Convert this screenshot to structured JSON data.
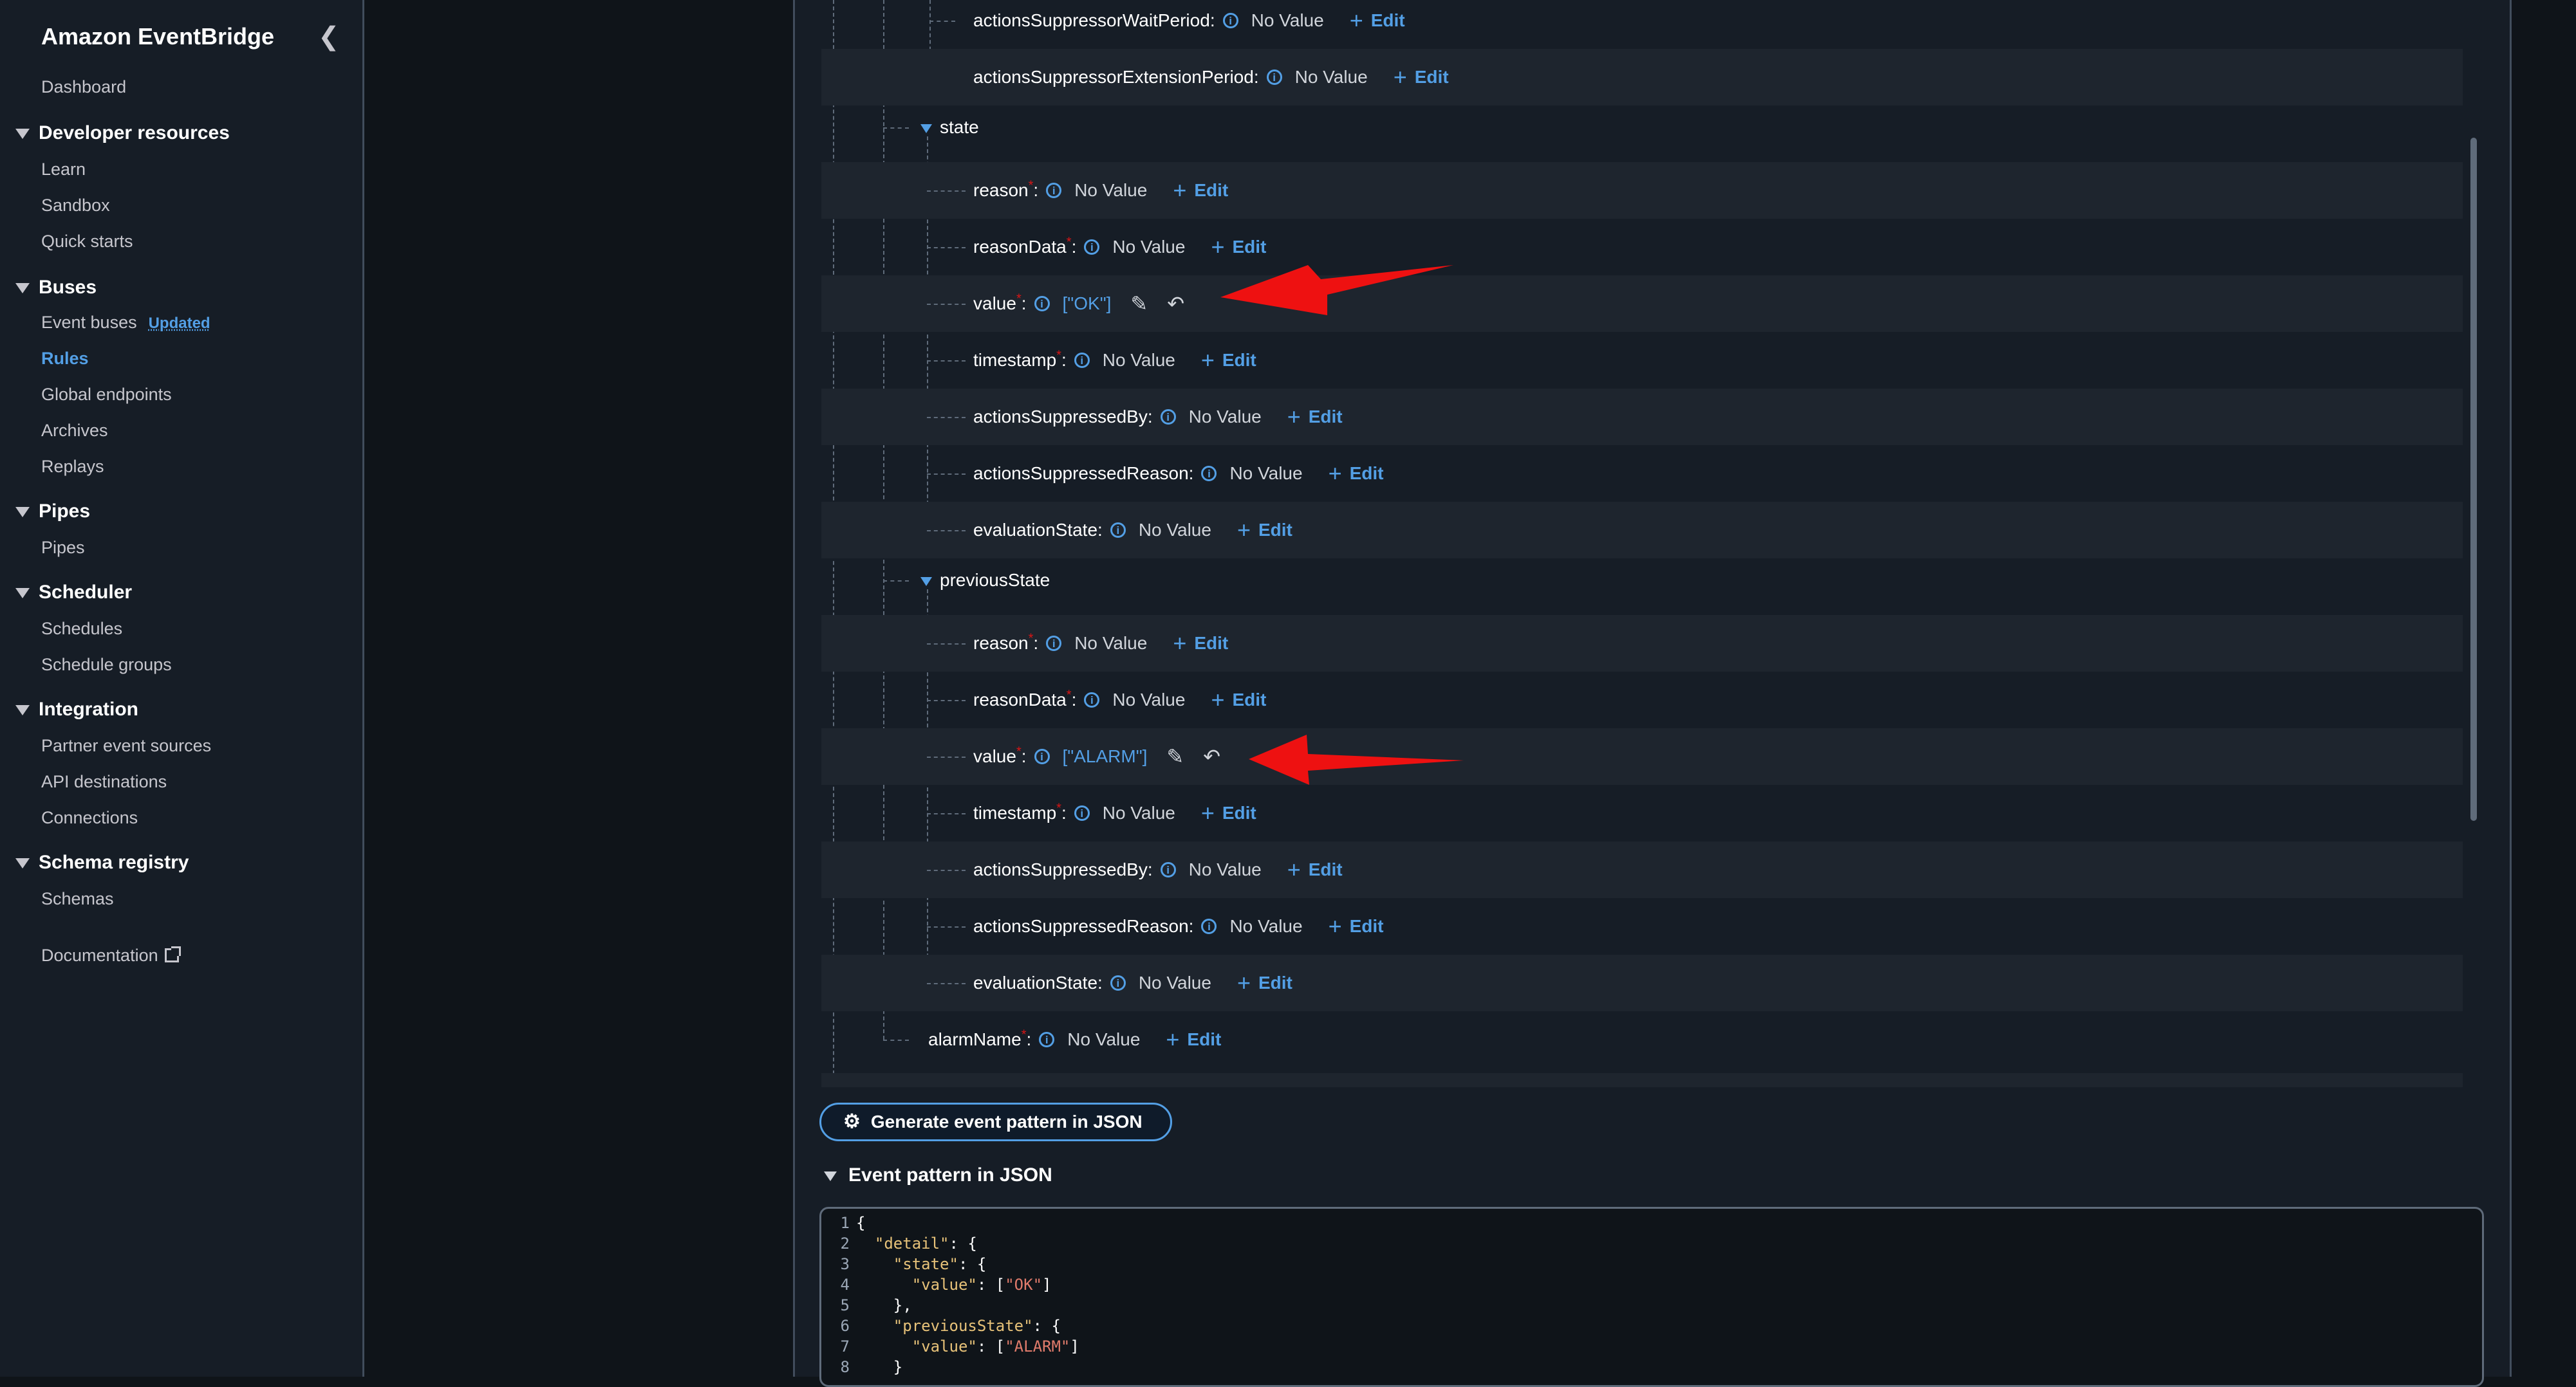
{
  "sidebar": {
    "title": "Amazon EventBridge",
    "dashboard": "Dashboard",
    "sections": [
      {
        "heading": "Developer resources",
        "items": [
          "Learn",
          "Sandbox",
          "Quick starts"
        ]
      },
      {
        "heading": "Buses",
        "items": [
          "Event buses",
          "Rules",
          "Global endpoints",
          "Archives",
          "Replays"
        ]
      },
      {
        "heading": "Pipes",
        "items": [
          "Pipes"
        ]
      },
      {
        "heading": "Scheduler",
        "items": [
          "Schedules",
          "Schedule groups"
        ]
      },
      {
        "heading": "Integration",
        "items": [
          "Partner event sources",
          "API destinations",
          "Connections"
        ]
      },
      {
        "heading": "Schema registry",
        "items": [
          "Schemas"
        ]
      }
    ],
    "event_buses_badge": "Updated",
    "active_item": "Rules",
    "documentation": "Documentation"
  },
  "tree": {
    "no_value": "No Value",
    "edit_label": "Edit",
    "top_fields": [
      "actionsSuppressorWaitPeriod",
      "actionsSuppressorExtensionPeriod"
    ],
    "state": {
      "label": "state",
      "fields": [
        "reason",
        "reasonData",
        "value",
        "timestamp",
        "actionsSuppressedBy",
        "actionsSuppressedReason",
        "evaluationState"
      ],
      "value": "[\"OK\"]"
    },
    "previousState": {
      "label": "previousState",
      "fields": [
        "reason",
        "reasonData",
        "value",
        "timestamp",
        "actionsSuppressedBy",
        "actionsSuppressedReason",
        "evaluationState"
      ],
      "value": "[\"ALARM\"]"
    },
    "alarmName": "alarmName"
  },
  "generate_button": "Generate event pattern in JSON",
  "json_section": {
    "heading": "Event pattern in JSON",
    "lines": [
      {
        "n": "1",
        "text": "{"
      },
      {
        "n": "2",
        "text": "  \"detail\": {"
      },
      {
        "n": "3",
        "text": "    \"state\": {"
      },
      {
        "n": "4",
        "text": "      \"value\": [\"OK\"]"
      },
      {
        "n": "5",
        "text": "    },"
      },
      {
        "n": "6",
        "text": "    \"previousState\": {"
      },
      {
        "n": "7",
        "text": "      \"value\": [\"ALARM\"]"
      },
      {
        "n": "8",
        "text": "    }"
      }
    ]
  },
  "colors": {
    "accent": "#539fe5",
    "required": "#d91515",
    "arrow": "#ee1111",
    "json_key": "#e7c279",
    "json_string": "#e07b6b"
  }
}
